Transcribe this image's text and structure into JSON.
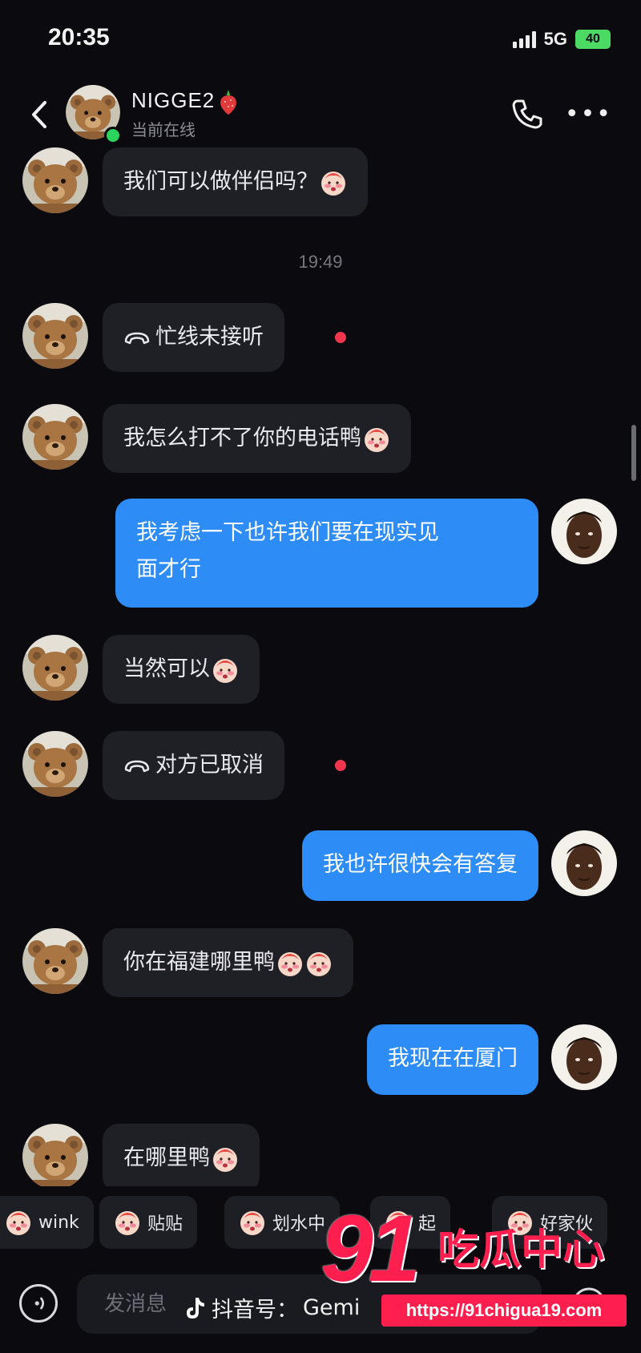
{
  "status_bar": {
    "time": "20:35",
    "network": "5G",
    "battery": "40"
  },
  "header": {
    "contact_name": "NIGGE2",
    "contact_status": "当前在线"
  },
  "messages": [
    {
      "side": "in",
      "text": "我们可以做伴侣吗？",
      "emoji": "blush-face-icon"
    },
    {
      "type": "timestamp",
      "text": "19:49"
    },
    {
      "side": "in",
      "type": "call",
      "text": "忙线未接听",
      "unread": true
    },
    {
      "side": "in",
      "text": "我怎么打不了你的电话鸭",
      "emoji": "blush-face-icon"
    },
    {
      "side": "out",
      "line1": "我考虑一下也许我们要在现实见",
      "line2": "面才行"
    },
    {
      "side": "in",
      "text": "当然可以",
      "emoji": "blush-face-icon"
    },
    {
      "side": "in",
      "type": "call",
      "text": "对方已取消",
      "unread": true
    },
    {
      "side": "out",
      "text": "我也许很快会有答复"
    },
    {
      "side": "in",
      "text": "你在福建哪里鸭",
      "emoji": "blush-face-icon"
    },
    {
      "side": "out",
      "text": "我现在在厦门"
    },
    {
      "side": "in",
      "text": "在哪里鸭",
      "emoji": "blush-face-icon"
    }
  ],
  "quick_replies": [
    {
      "label": "wink"
    },
    {
      "label": "贴贴"
    },
    {
      "label": "划水中"
    },
    {
      "label": "起"
    },
    {
      "label": "好家伙"
    }
  ],
  "input": {
    "placeholder": "发消息"
  },
  "tiktok_id": {
    "label": "抖音号：",
    "value": "Gemi"
  },
  "watermark": {
    "number": "91",
    "text": "吃瓜中心",
    "url": "https://91chigua19.com"
  },
  "colors": {
    "background": "#0a0a0f",
    "incoming_bubble": "#1f1f26",
    "outgoing_bubble": "#2d8cf6",
    "unread_dot": "#f0364c",
    "online": "#2bd45d",
    "watermark": "#ff1f4e"
  }
}
